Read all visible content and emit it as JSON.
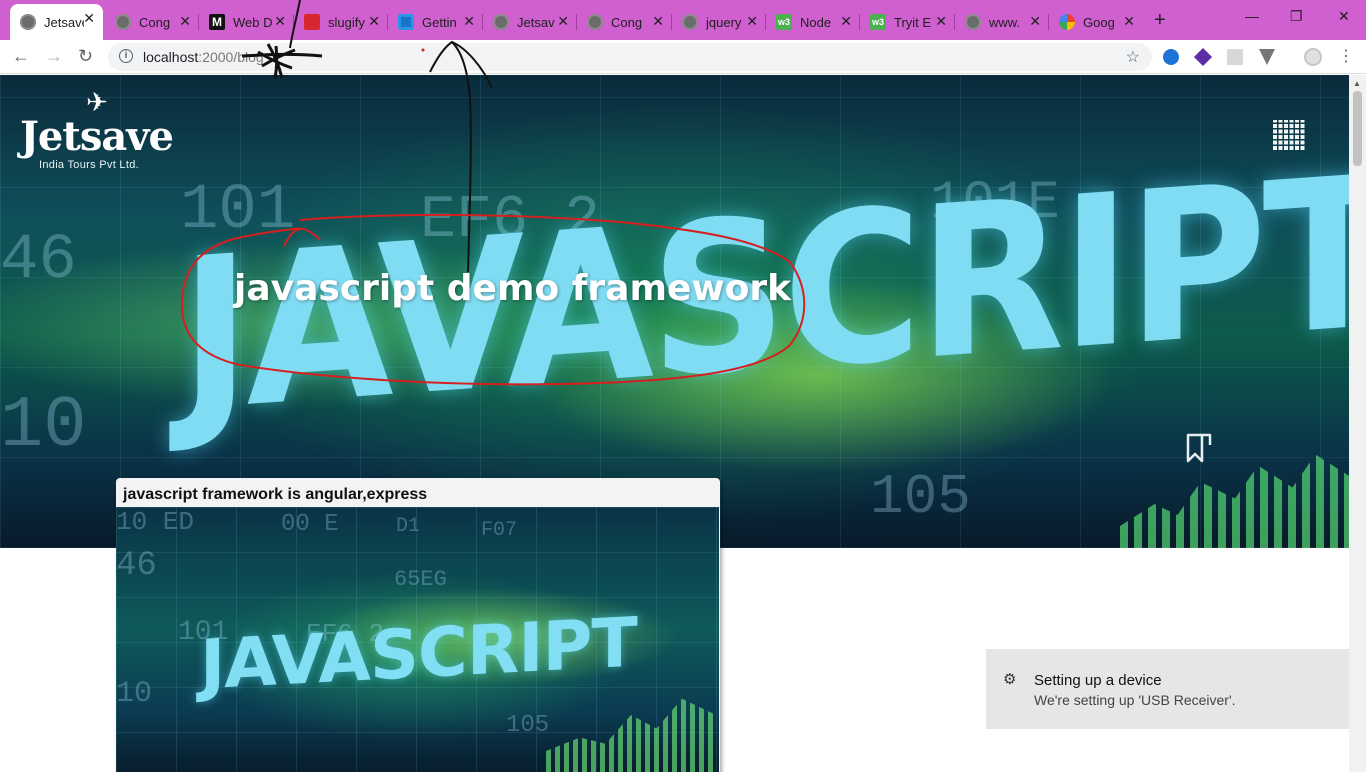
{
  "browser": {
    "tabs": [
      {
        "title": "Jetsave",
        "favicon": "globe-icon",
        "active": true
      },
      {
        "title": "Cong",
        "favicon": "globe-icon"
      },
      {
        "title": "Web D",
        "favicon": "medium-icon"
      },
      {
        "title": "slugify",
        "favicon": "npm-icon"
      },
      {
        "title": "Gettin",
        "favicon": "blue-square-icon"
      },
      {
        "title": "Jetsav",
        "favicon": "globe-icon"
      },
      {
        "title": "Cong",
        "favicon": "globe-icon"
      },
      {
        "title": "jquery",
        "favicon": "globe-icon"
      },
      {
        "title": "Node",
        "favicon": "w3schools-icon"
      },
      {
        "title": "Tryit E",
        "favicon": "w3schools-icon"
      },
      {
        "title": "www.",
        "favicon": "globe-icon"
      },
      {
        "title": "Goog",
        "favicon": "google-icon"
      }
    ],
    "new_tab": "+",
    "close_glyph": "✕",
    "window": {
      "minimize": "—",
      "maximize": "❐",
      "close": "✕"
    },
    "nav": {
      "back": "←",
      "forward": "→",
      "reload": "↻"
    },
    "address": {
      "host": "localhost",
      "port": ":2000",
      "path": "/blog"
    },
    "bookmark_star": "☆",
    "menu": "⋮"
  },
  "site": {
    "logo": {
      "name": "Jetsave",
      "subtitle": "India Tours Pvt Ltd.",
      "plane": "✈"
    },
    "hero_title": "javascript demo framework",
    "hero_word": "JAVASCRIPT",
    "hero_hex": [
      "101",
      "EF6 2",
      "101E",
      "46",
      "10",
      "105",
      "10 ED"
    ],
    "card": {
      "title": "javascript framework is angular,express",
      "image_word": "JAVASCRIPT",
      "image_hex": [
        "10 ED",
        "00 E",
        "D1",
        "F07",
        "46",
        "101",
        "EF6 2",
        "65EG",
        "105",
        "10"
      ]
    }
  },
  "toast": {
    "icon": "⚙",
    "title": "Setting up a device",
    "message": "We're setting up 'USB Receiver'."
  },
  "colors": {
    "tabbar": "#d05fd0",
    "annotation_red": "#d61f1f",
    "annotation_black": "#111111"
  }
}
